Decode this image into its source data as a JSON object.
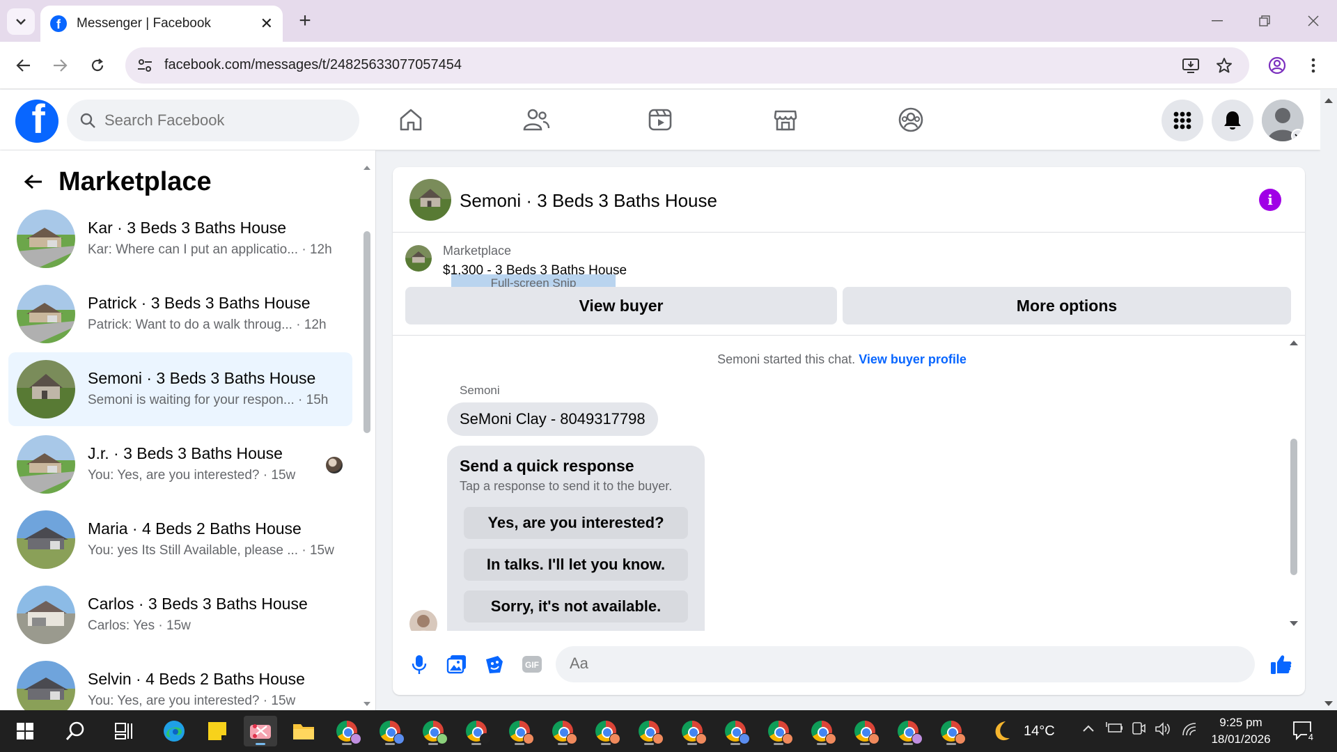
{
  "browser": {
    "tab_title": "Messenger | Facebook",
    "url": "facebook.com/messages/t/24825633077057454",
    "tab_close": "✕",
    "new_tab": "+"
  },
  "header": {
    "logo_letter": "f",
    "search_placeholder": "Search Facebook"
  },
  "sidebar": {
    "title": "Marketplace",
    "conversations": [
      {
        "name": "Kar · 3 Beds 3 Baths House",
        "preview": "Kar: Where can I put an applicatio...",
        "time": "· 12h"
      },
      {
        "name": "Patrick · 3 Beds 3 Baths House",
        "preview": "Patrick: Want to do a walk throug...",
        "time": "· 12h"
      },
      {
        "name": "Semoni · 3 Beds 3 Baths House",
        "preview": "Semoni is waiting for your respon...",
        "time": "· 15h"
      },
      {
        "name": "J.r. · 3 Beds 3 Baths House",
        "preview": "You: Yes, are you interested?",
        "time": "· 15w"
      },
      {
        "name": "Maria · 4 Beds 2 Baths House",
        "preview": "You: yes Its Still Available, please ...",
        "time": "· 15w"
      },
      {
        "name": "Carlos · 3 Beds 3 Baths House",
        "preview": "Carlos: Yes",
        "time": "· 15w"
      },
      {
        "name": "Selvin · 4 Beds 2 Baths House",
        "preview": "You: Yes, are you interested?",
        "time": "· 15w"
      }
    ]
  },
  "chat": {
    "title": "Semoni · 3 Beds 3 Baths House",
    "listing_category": "Marketplace",
    "listing_price_title": "$1,300 - 3 Beds 3 Baths House",
    "snip_overlay": "Full-screen Snip",
    "view_buyer_label": "View buyer",
    "more_options_label": "More options",
    "system_message": "Semoni started this chat.",
    "system_link": "View buyer profile",
    "sender": "Semoni",
    "message": "SeMoni Clay - 8049317798",
    "quick_response": {
      "title": "Send a quick response",
      "subtitle": "Tap a response to send it to the buyer.",
      "options": [
        "Yes, are you interested?",
        "In talks. I'll let you know.",
        "Sorry, it's not available."
      ]
    },
    "composer_placeholder": "Aa"
  },
  "taskbar": {
    "weather_temp": "14°C",
    "time": "9:25 pm",
    "date": "18/01/2026",
    "notification_count": "4"
  },
  "colors": {
    "facebook_blue": "#0866ff",
    "info_purple": "#a000e6",
    "active_row": "#ebf5ff"
  }
}
